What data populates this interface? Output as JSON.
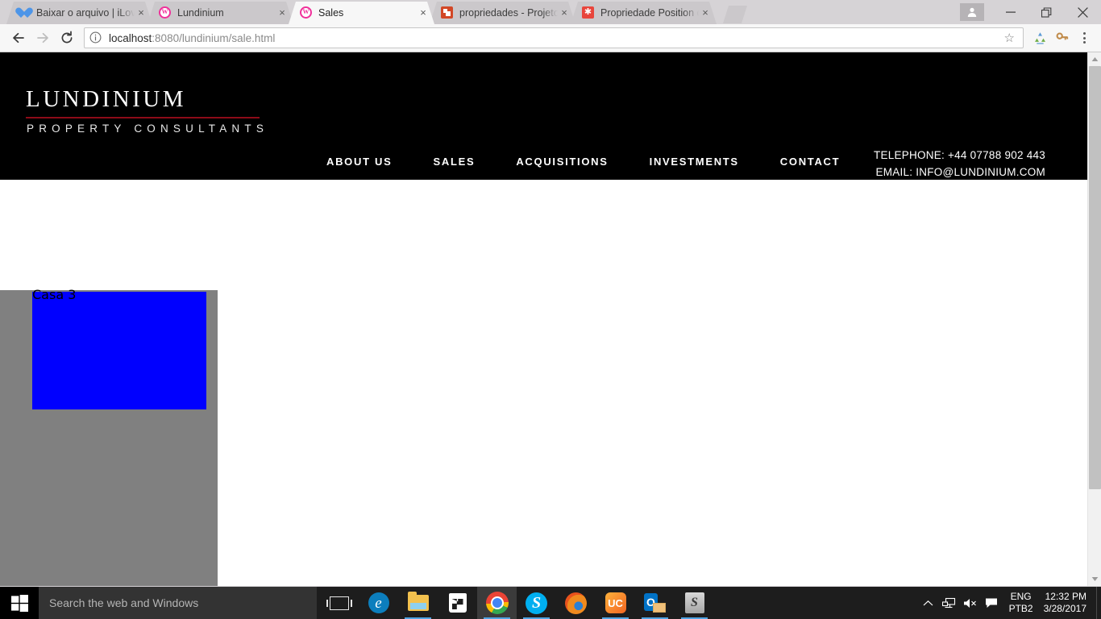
{
  "browser": {
    "tabs": [
      {
        "title": "Baixar o arquivo | iLoveIM",
        "favicon": "heart-icon",
        "active": false,
        "close_label": "×"
      },
      {
        "title": "Lundinium",
        "favicon": "w-circle-icon",
        "active": false,
        "close_label": "×"
      },
      {
        "title": "Sales",
        "favicon": "w-circle-icon",
        "active": true,
        "close_label": "×"
      },
      {
        "title": "propriedades - Projeto L",
        "favicon": "powerpoint-icon",
        "active": false,
        "close_label": "×"
      },
      {
        "title": "Propriedade Position do",
        "favicon": "star-red-icon",
        "active": false,
        "close_label": "×"
      }
    ],
    "omnibox": {
      "host": "localhost",
      "path": ":8080/lundinium/sale.html",
      "full_url": "localhost:8080/lundinium/sale.html",
      "info_icon": "info-circle-icon",
      "bookmark_icon": "star-outline-icon"
    },
    "toolbar": {
      "back_icon": "arrow-left-icon",
      "forward_icon": "arrow-right-icon",
      "reload_icon": "reload-icon",
      "extension_1_icon": "recycle-icon",
      "extension_2_icon": "key-icon",
      "menu_icon": "three-dot-menu-icon"
    },
    "window_controls": {
      "profile_icon": "person-icon",
      "minimize": "—",
      "maximize": "❐",
      "close": "✕"
    },
    "scrollbar": {
      "up_arrow": "▲",
      "down_arrow": "▼"
    }
  },
  "site": {
    "logo": {
      "name": "LUNDINIUM",
      "tagline": "PROPERTY CONSULTANTS",
      "rule_color": "#8d0b18"
    },
    "nav": [
      {
        "label": "ABOUT US"
      },
      {
        "label": "SALES"
      },
      {
        "label": "ACQUISITIONS"
      },
      {
        "label": "INVESTMENTS"
      },
      {
        "label": "CONTACT"
      }
    ],
    "contact": {
      "telephone": "TELEPHONE: +44 07788 902 443",
      "email": "EMAIL: INFO@LUNDINIUM.COM"
    },
    "header_bg": "#000000",
    "listing": {
      "container_bg": "#808080",
      "card_color": "#0000ff",
      "card_label": "Casa 3"
    }
  },
  "taskbar": {
    "start_icon": "windows-logo-icon",
    "search_placeholder": "Search the web and Windows",
    "items": [
      {
        "name": "task-view",
        "icon": "task-view-icon",
        "running": false,
        "active": false
      },
      {
        "name": "edge",
        "icon": "edge-icon",
        "running": false,
        "active": false
      },
      {
        "name": "file-explorer",
        "icon": "folder-icon",
        "running": true,
        "active": false
      },
      {
        "name": "store",
        "icon": "store-icon",
        "running": false,
        "active": false
      },
      {
        "name": "chrome",
        "icon": "chrome-icon",
        "running": true,
        "active": true
      },
      {
        "name": "skype",
        "icon": "skype-icon",
        "running": true,
        "active": false
      },
      {
        "name": "firefox",
        "icon": "firefox-icon",
        "running": false,
        "active": false
      },
      {
        "name": "uc-browser",
        "icon": "uc-browser-icon",
        "running": true,
        "active": false
      },
      {
        "name": "outlook",
        "icon": "outlook-icon",
        "running": true,
        "active": false
      },
      {
        "name": "sublime-text",
        "icon": "sublime-text-icon",
        "running": true,
        "active": false
      }
    ],
    "tray": {
      "chevron_icon": "chevron-up-icon",
      "network_icon": "network-icon",
      "volume_icon": "volume-muted-icon",
      "action_center_icon": "notification-flag-icon",
      "lang_line1": "ENG",
      "lang_line2": "PTB2",
      "time": "12:32 PM",
      "date": "3/28/2017"
    }
  }
}
